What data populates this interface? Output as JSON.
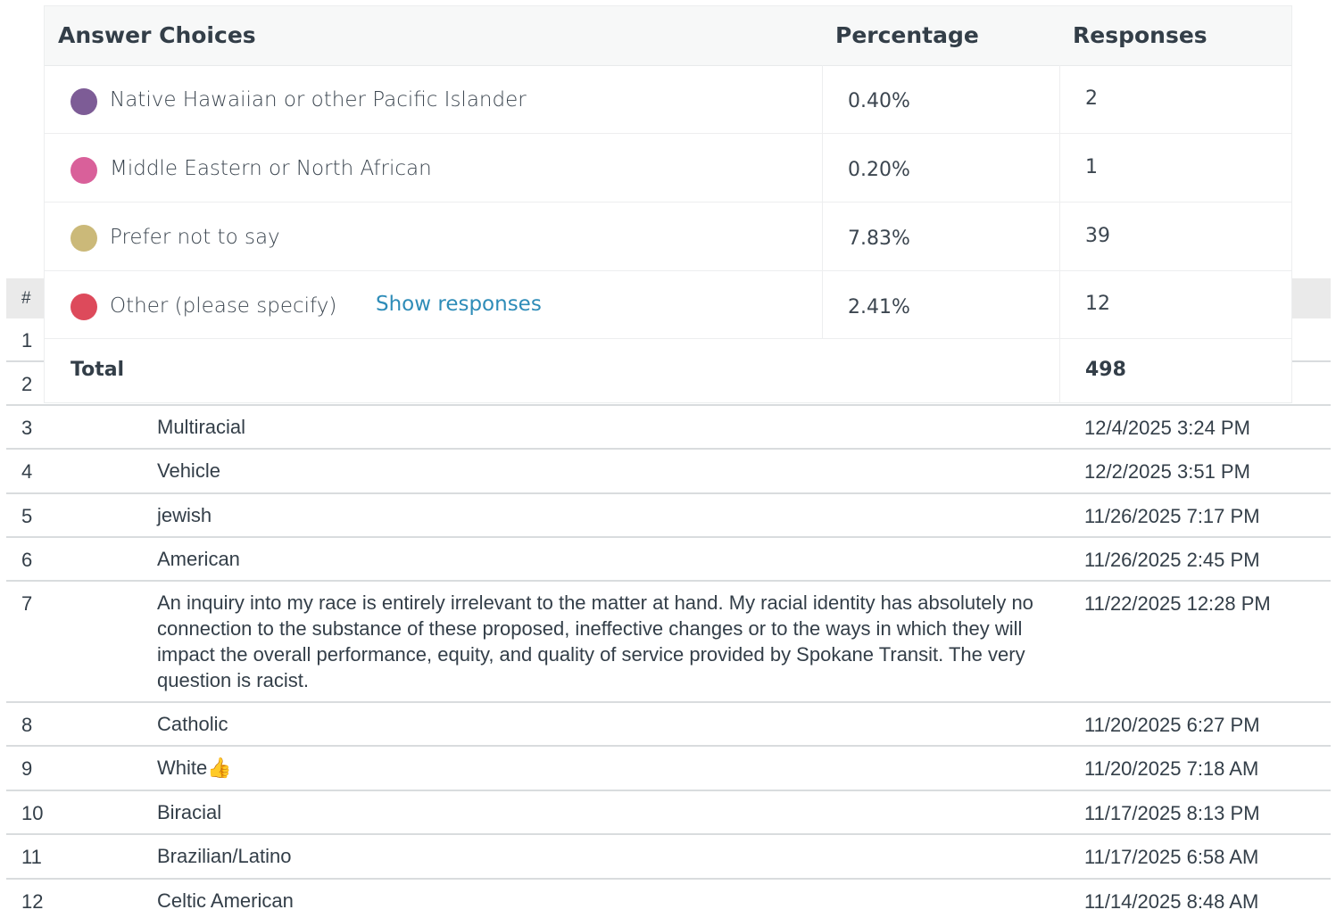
{
  "responses_table": {
    "header_num": "#",
    "rows": [
      {
        "num": "1",
        "text": "",
        "date": ""
      },
      {
        "num": "2",
        "text": "",
        "date": ""
      },
      {
        "num": "3",
        "text": "Multiracial",
        "date": "12/4/2025 3:24 PM"
      },
      {
        "num": "4",
        "text": "Vehicle",
        "date": "12/2/2025 3:51 PM"
      },
      {
        "num": "5",
        "text": "jewish",
        "date": "11/26/2025 7:17 PM"
      },
      {
        "num": "6",
        "text": "American",
        "date": "11/26/2025 2:45 PM"
      },
      {
        "num": "7",
        "text": "An inquiry into my race is entirely irrelevant to the matter at hand. My racial identity has absolutely no connection to the substance of these proposed, ineffective changes or to the ways in which they will impact the overall performance, equity, and quality of service provided by Spokane Transit. The very question is racist.",
        "date": "11/22/2025 12:28 PM"
      },
      {
        "num": "8",
        "text": "Catholic",
        "date": "11/20/2025 6:27 PM"
      },
      {
        "num": "9",
        "text": "White👍",
        "date": "11/20/2025 7:18 AM"
      },
      {
        "num": "10",
        "text": "Biracial",
        "date": "11/17/2025 8:13 PM"
      },
      {
        "num": "11",
        "text": "Brazilian/Latino",
        "date": "11/17/2025 6:58 AM"
      },
      {
        "num": "12",
        "text": "Celtic American",
        "date": "11/14/2025 8:48 AM"
      }
    ]
  },
  "summary": {
    "headers": {
      "choices": "Answer Choices",
      "percentage": "Percentage",
      "responses": "Responses"
    },
    "rows": [
      {
        "label": "Native Hawaiian or other Pacific Islander",
        "pct": "0.40%",
        "count": "2",
        "color": "#7d5c96"
      },
      {
        "label": "Middle Eastern or North African",
        "pct": "0.20%",
        "count": "1",
        "color": "#d9609a"
      },
      {
        "label": "Prefer not to say",
        "pct": "7.83%",
        "count": "39",
        "color": "#cbb979"
      },
      {
        "label": "Other (please specify)",
        "pct": "2.41%",
        "count": "12",
        "color": "#dd4a5b"
      }
    ],
    "show_responses": "Show responses",
    "total_label": "Total",
    "total_value": "498"
  }
}
